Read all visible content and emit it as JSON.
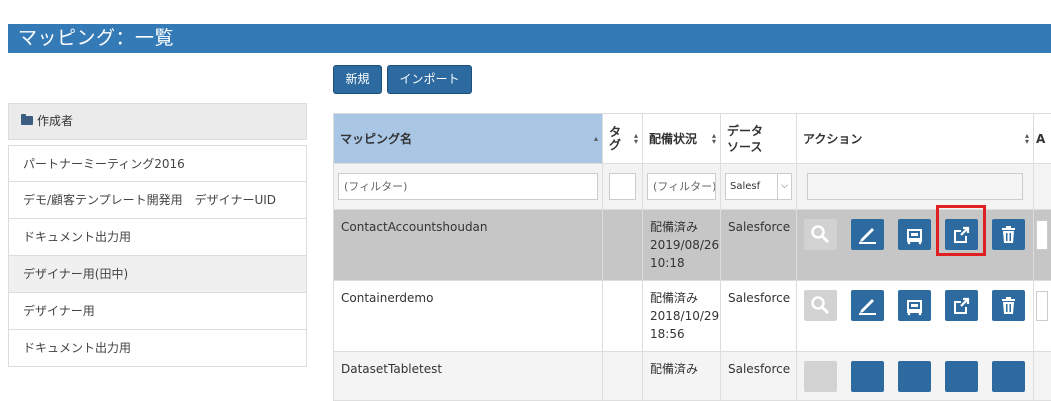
{
  "header": {
    "title": "マッピング：一覧"
  },
  "toolbar": {
    "new_label": "新規",
    "import_label": "インポート"
  },
  "sidebar": {
    "heading": "作成者",
    "items": [
      {
        "label": "パートナーミーティング2016",
        "selected": false
      },
      {
        "label": "デモ/顧客テンプレート開発用　デザイナーUID",
        "selected": false
      },
      {
        "label": "ドキュメント出力用",
        "selected": false
      },
      {
        "label": "デザイナー用(田中)",
        "selected": true
      },
      {
        "label": "デザイナー用",
        "selected": false
      },
      {
        "label": "ドキュメント出力用",
        "selected": false
      }
    ]
  },
  "table": {
    "columns": [
      "マッピング名",
      "タグ",
      "配備状況",
      "データソース",
      "アクション",
      "A"
    ],
    "tag_header_lines": [
      "タ",
      "グ"
    ],
    "datasource_header_lines": [
      "データ",
      "ソース"
    ],
    "filters": {
      "name_placeholder": "(フィルター)",
      "status_placeholder": "(フィルター)",
      "datasource_value": "Salesf"
    },
    "rows": [
      {
        "name": "ContactAccountshoudan",
        "tag": "",
        "status": "配備済み",
        "date": "2019/08/26",
        "time": "10:18",
        "datasource": "Salesforce"
      },
      {
        "name": "Containerdemo",
        "tag": "",
        "status": "配備済み",
        "date": "2018/10/29",
        "time": "18:56",
        "datasource": "Salesforce"
      },
      {
        "name": "DatasetTabletest",
        "tag": "",
        "status": "配備済み",
        "date": "",
        "time": "",
        "datasource": "Salesforce"
      }
    ]
  },
  "colors": {
    "title_bar": "#337ab7",
    "button": "#2d6a9f",
    "sorted_header": "#a9c6e4",
    "highlight": "#e02020"
  },
  "icons": [
    "search-icon",
    "edit-icon",
    "deploy-icon",
    "export-icon",
    "trash-icon"
  ]
}
